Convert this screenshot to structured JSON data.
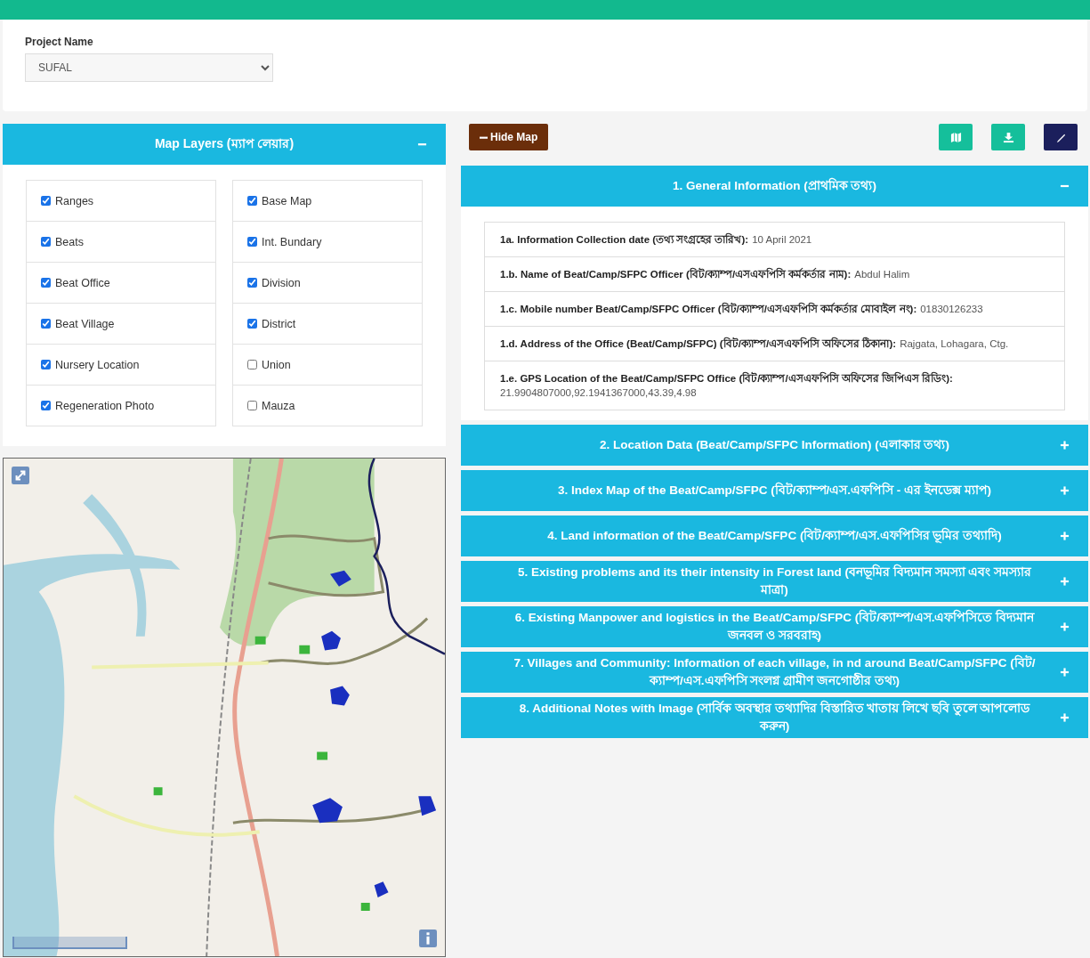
{
  "project": {
    "label": "Project Name",
    "value": "SUFAL"
  },
  "layers": {
    "title": "Map Layers (ম্যাপ লেয়ার)",
    "expanded": true,
    "columns": [
      [
        {
          "label": "Ranges",
          "checked": true
        },
        {
          "label": "Beats",
          "checked": true
        },
        {
          "label": "Beat Office",
          "checked": true
        },
        {
          "label": "Beat Village",
          "checked": true
        },
        {
          "label": "Nursery Location",
          "checked": true
        },
        {
          "label": "Regeneration Photo",
          "checked": true
        }
      ],
      [
        {
          "label": "Base Map",
          "checked": true
        },
        {
          "label": "Int. Bundary",
          "checked": true
        },
        {
          "label": "Division",
          "checked": true
        },
        {
          "label": "District",
          "checked": true
        },
        {
          "label": "Union",
          "checked": false
        },
        {
          "label": "Mauza",
          "checked": false
        }
      ]
    ]
  },
  "toolbar": {
    "hide_map": "Hide Map"
  },
  "sections": [
    {
      "title": "1. General Information (প্রাথমিক তথ্য)",
      "expanded": true,
      "fields": [
        {
          "label": "1a. Information Collection date (তথ্য সংগ্রহের তারিখ):",
          "value": "10 April 2021"
        },
        {
          "label": "1.b. Name of Beat/Camp/SFPC Officer (বিট/ক্যাম্প/এসএফপিসি কর্মকর্তার নাম):",
          "value": "Abdul Halim"
        },
        {
          "label": "1.c. Mobile number Beat/Camp/SFPC Officer (বিট/ক্যাম্প/এসএফপিসি কর্মকর্তার মোবাইল নং):",
          "value": "01830126233"
        },
        {
          "label": "1.d. Address of the Office (Beat/Camp/SFPC) (বিট/ক্যাম্প/এসএফপিসি অফিসের ঠিকানা):",
          "value": "Rajgata, Lohagara, Ctg."
        },
        {
          "label": "1.e. GPS Location of the Beat/Camp/SFPC Office (বিট/ক্যাম্প/এসএফপিসি অফিসের জিপিএস রিডিং):",
          "value": "21.9904807000,92.1941367000,43.39,4.98"
        }
      ]
    },
    {
      "title": "2. Location Data (Beat/Camp/SFPC Information) (এলাকার তথ্য)",
      "expanded": false
    },
    {
      "title": "3. Index Map of the Beat/Camp/SFPC (বিট/ক্যাম্প/এস.এফপিসি - এর ইনডেক্স ম্যাপ)",
      "expanded": false
    },
    {
      "title": "4. Land information of the Beat/Camp/SFPC (বিট/ক্যাম্প/এস.এফপিসির ভূমির তথ্যাদি)",
      "expanded": false
    },
    {
      "title": "5. Existing problems and its their intensity in Forest land (বনভূমির বিদ্যমান সমস্যা এবং সমস্যার মাত্রা)",
      "expanded": false
    },
    {
      "title": "6. Existing Manpower and logistics in the Beat/Camp/SFPC (বিট/ক্যাম্প/এস.এফপিসিতে বিদ্যমান জনবল ও সরবরাহ)",
      "expanded": false
    },
    {
      "title": "7. Villages and Community: Information of each village, in nd around Beat/Camp/SFPC (বিট/ক্যাম্প/এস.এফপিসি সংলগ্ন গ্রামীণ জনগোষ্ঠীর তথ্য)",
      "expanded": false
    },
    {
      "title": "8. Additional Notes with Image (সার্বিক অবস্থার তথ্যাদির বিস্তারিত খাতায় লিখে ছবি তুলে আপলোড করুন)",
      "expanded": false
    }
  ]
}
